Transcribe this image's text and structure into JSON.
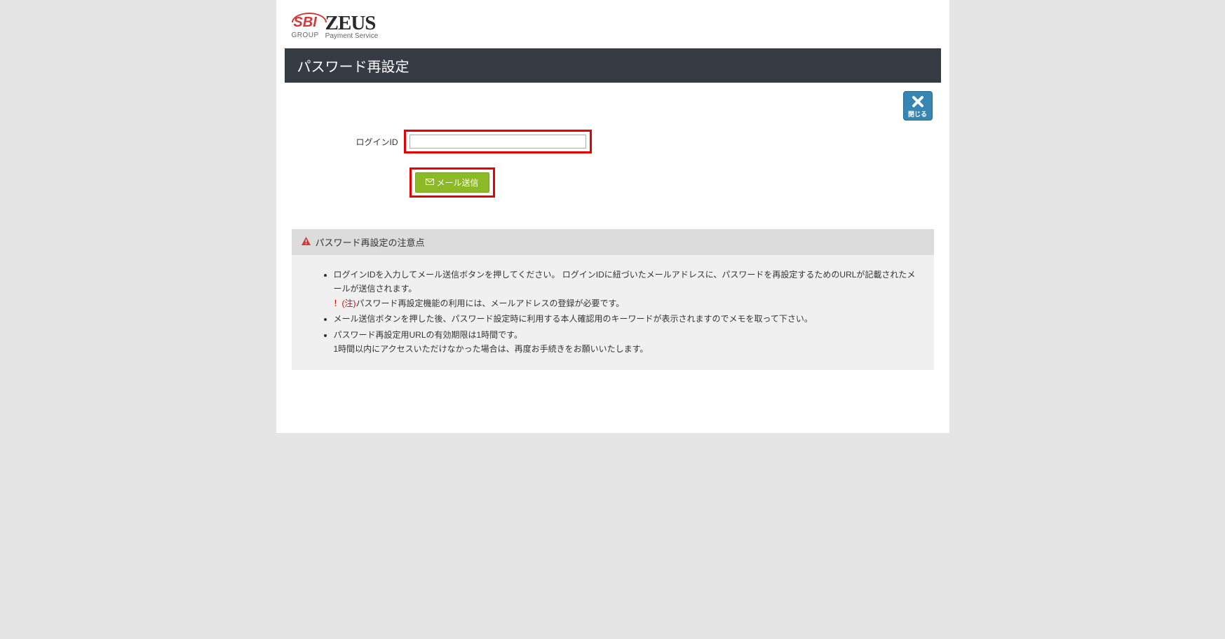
{
  "logo": {
    "sbi_text": "SBI",
    "sbi_group": "GROUP",
    "zeus_main": "ZEUS",
    "zeus_sub": "Payment Service"
  },
  "page_title": "パスワード再設定",
  "close_button_label": "閉じる",
  "form": {
    "login_id_label": "ログインID",
    "login_id_value": "",
    "send_button_label": "メール送信"
  },
  "notice": {
    "title": "パスワード再設定の注意点",
    "items": [
      {
        "text": "ログインIDを入力してメール送信ボタンを押してください。 ログインIDに紐づいたメールアドレスに、パスワードを再設定するためのURLが記載されたメールが送信されます。",
        "warn_prefix": "！(注)",
        "warn_text": "パスワード再設定機能の利用には、メールアドレスの登録が必要です。"
      },
      {
        "text": "メール送信ボタンを押した後、パスワード設定時に利用する本人確認用のキーワードが表示されますのでメモを取って下さい。"
      },
      {
        "text": "パスワード再設定用URLの有効期限は1時間です。",
        "sub_text": "1時間以内にアクセスいただけなかった場合は、再度お手続きをお願いいたします。"
      }
    ]
  }
}
